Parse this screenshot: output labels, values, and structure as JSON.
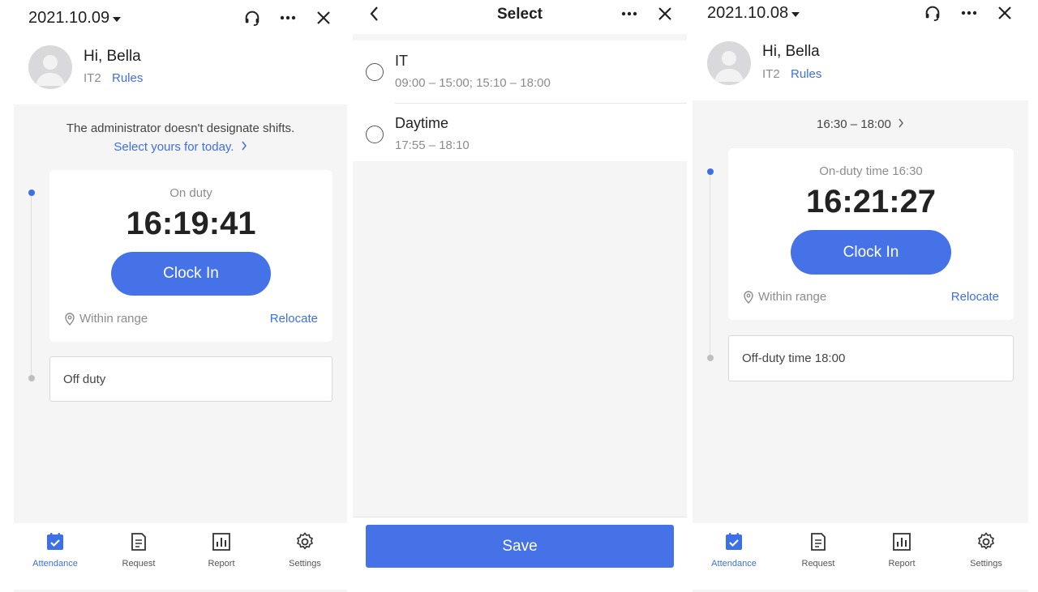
{
  "colors": {
    "accent": "#4672e8",
    "link": "#3d6fe6",
    "muted": "#8c8c8c",
    "background": "#f5f5f6"
  },
  "left": {
    "date": "2021.10.09",
    "icons": [
      "headset-icon",
      "more-icon",
      "close-icon"
    ],
    "greeting": "Hi, Bella",
    "dept": "IT2",
    "rules_label": "Rules",
    "notice_line1": "The administrator doesn't designate shifts.",
    "notice_link": "Select yours for today.",
    "on_duty_label": "On duty",
    "time": "16:19:41",
    "clock_in_label": "Clock In",
    "location_status": "Within range",
    "relocate_label": "Relocate",
    "off_duty_label": "Off duty"
  },
  "middle": {
    "title": "Select",
    "options": [
      {
        "name": "IT",
        "hours": "09:00 – 15:00; 15:10 – 18:00"
      },
      {
        "name": "Daytime",
        "hours": "17:55 – 18:10"
      }
    ],
    "save_label": "Save"
  },
  "right": {
    "date": "2021.10.08",
    "greeting": "Hi, Bella",
    "dept": "IT2",
    "rules_label": "Rules",
    "shift_range": "16:30 – 18:00",
    "on_duty_time": "On-duty time 16:30",
    "time": "16:21:27",
    "clock_in_label": "Clock In",
    "location_status": "Within range",
    "relocate_label": "Relocate",
    "off_duty_time": "Off-duty time 18:00"
  },
  "tabs": [
    {
      "label": "Attendance",
      "icon": "calendar-check-icon",
      "active": true
    },
    {
      "label": "Request",
      "icon": "document-icon",
      "active": false
    },
    {
      "label": "Report",
      "icon": "bar-chart-icon",
      "active": false
    },
    {
      "label": "Settings",
      "icon": "gear-icon",
      "active": false
    }
  ]
}
